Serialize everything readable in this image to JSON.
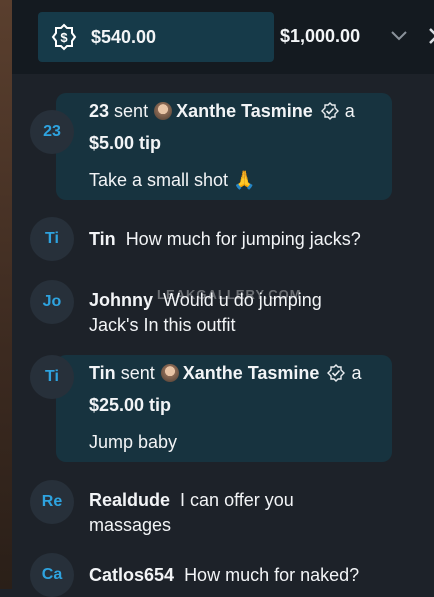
{
  "goal": {
    "current": "$540.00",
    "target": "$1,000.00",
    "progress_fraction": 0.54,
    "icon": "goal-dollar-icon"
  },
  "watermark": "LEAKGALLERY.COM",
  "messages": [
    {
      "avatar": "23",
      "sender": "23",
      "verb": "sent",
      "recipient": "Xanthe Tasmine",
      "tail": "a",
      "amount": "$5.00 tip",
      "note": "Take a small shot 🙏"
    },
    {
      "avatar": "Ti",
      "sender": "Tin",
      "text": "How much for jumping jacks?"
    },
    {
      "avatar": "Jo",
      "sender": "Johnny",
      "text": "Would u do jumping",
      "text2": "Jack's In this outfit"
    },
    {
      "avatar": "Ti",
      "sender": "Tin",
      "verb": "sent",
      "recipient": "Xanthe Tasmine",
      "tail": "a",
      "amount": "$25.00 tip",
      "note": "Jump baby"
    },
    {
      "avatar": "Re",
      "sender": "Realdude",
      "text": "I can offer you",
      "text2": "massages"
    },
    {
      "avatar": "Ca",
      "sender": "Catlos654",
      "text": "How much for naked?"
    }
  ]
}
